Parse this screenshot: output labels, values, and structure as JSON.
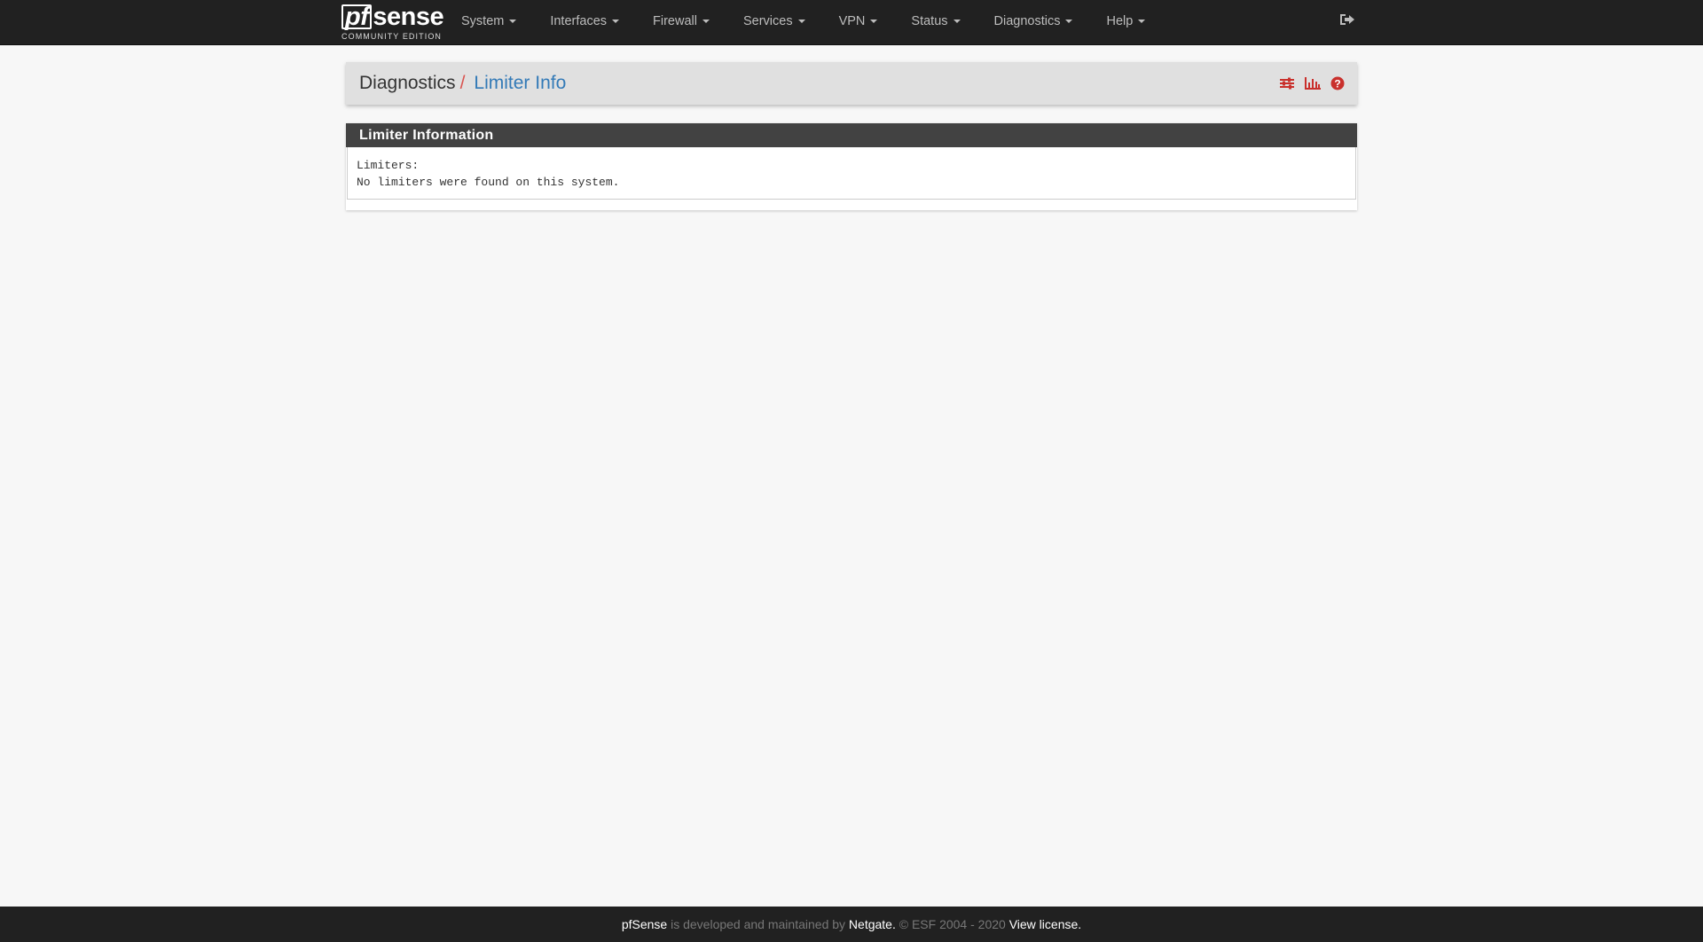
{
  "brand": {
    "logo_text": "pfsense",
    "subtitle": "COMMUNITY EDITION"
  },
  "nav": {
    "items": [
      {
        "label": "System"
      },
      {
        "label": "Interfaces"
      },
      {
        "label": "Firewall"
      },
      {
        "label": "Services"
      },
      {
        "label": "VPN"
      },
      {
        "label": "Status"
      },
      {
        "label": "Diagnostics"
      },
      {
        "label": "Help"
      }
    ],
    "logout_icon": "sign-out-icon"
  },
  "breadcrumb": {
    "parent": "Diagnostics",
    "separator": "/",
    "current": "Limiter Info",
    "icons": [
      "sliders-icon",
      "bar-chart-icon",
      "question-circle-icon"
    ]
  },
  "panel": {
    "title": "Limiter Information",
    "line1": "Limiters:",
    "line2": "No limiters were found on this system."
  },
  "footer": {
    "brand": "pfSense",
    "text1": " is developed and maintained by ",
    "maintainer": "Netgate.",
    "text2": " © ESF 2004 - 2020 ",
    "license_link": "View license."
  },
  "colors": {
    "navbar_bg": "#212121",
    "accent_red": "#d9534f",
    "link_blue": "#337ab7",
    "icon_red": "#c9302c",
    "panel_heading_bg": "#424242"
  }
}
